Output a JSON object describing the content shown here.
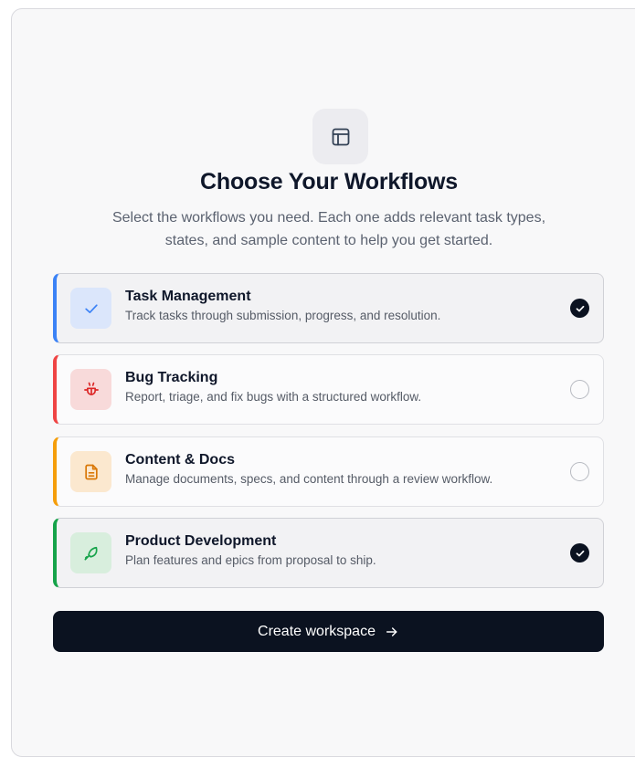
{
  "header": {
    "icon": "layout-panel-icon",
    "title": "Choose Your Workflows",
    "subtitle": "Select the workflows you need. Each one adds relevant task types, states, and sample content to help you get started."
  },
  "workflows": [
    {
      "name": "Task Management",
      "description": "Track tasks through submission, progress, and resolution.",
      "icon": "check-icon",
      "accent": "#3b82f6",
      "icon_bg": "#dbe6fb",
      "selected": true
    },
    {
      "name": "Bug Tracking",
      "description": "Report, triage, and fix bugs with a structured workflow.",
      "icon": "bug-icon",
      "accent": "#ef4444",
      "icon_bg": "#f8dada",
      "selected": false
    },
    {
      "name": "Content & Docs",
      "description": "Manage documents, specs, and content through a review workflow.",
      "icon": "document-icon",
      "accent": "#f59e0b",
      "icon_bg": "#fbe8cf",
      "selected": false
    },
    {
      "name": "Product Development",
      "description": "Plan features and epics from proposal to ship.",
      "icon": "rocket-icon",
      "accent": "#16a34a",
      "icon_bg": "#d8eedd",
      "selected": true
    }
  ],
  "cta": {
    "label": "Create workspace",
    "icon": "arrow-right-icon"
  }
}
